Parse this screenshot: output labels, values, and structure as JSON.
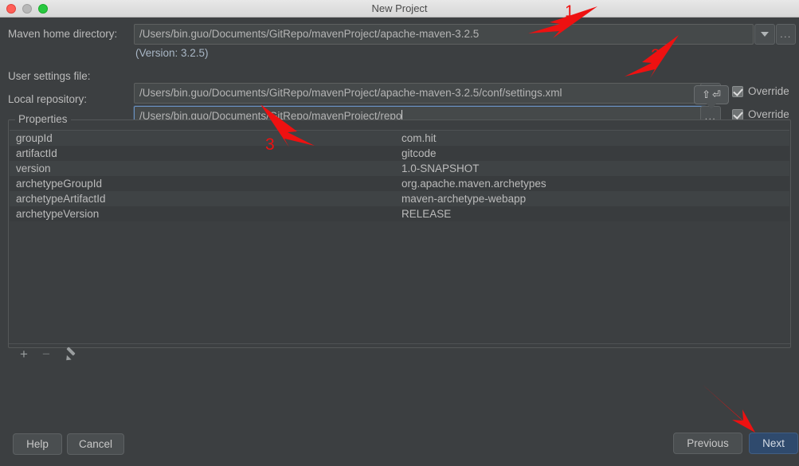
{
  "window": {
    "title": "New Project",
    "traffic_lights": [
      "close-button",
      "minimize-button",
      "maximize-button"
    ]
  },
  "form": {
    "maven_home": {
      "label": "Maven home directory:",
      "value": "/Users/bin.guo/Documents/GitRepo/mavenProject/apache-maven-3.2.5",
      "dropdown_icon": "chevron-down-icon",
      "browse_label": "...",
      "version_note": "(Version: 3.2.5)"
    },
    "user_settings": {
      "label": "User settings file:",
      "value": "/Users/bin.guo/Documents/GitRepo/mavenProject/apache-maven-3.2.5/conf/settings.xml",
      "browse_label": "...",
      "override_label": "Override",
      "override_checked": true
    },
    "local_repository": {
      "label": "Local repository:",
      "value": "/Users/bin.guo/Documents/GitRepo/mavenProject/repo",
      "browse_label": "...",
      "override_label": "Override",
      "override_checked": true,
      "focused": true
    }
  },
  "shortcut_tooltip": {
    "shift_glyph": "⇧",
    "enter_glyph": "⏎"
  },
  "properties": {
    "legend": "Properties",
    "rows": [
      {
        "key": "groupId",
        "value": "com.hit"
      },
      {
        "key": "artifactId",
        "value": "gitcode"
      },
      {
        "key": "version",
        "value": "1.0-SNAPSHOT"
      },
      {
        "key": "archetypeGroupId",
        "value": "org.apache.maven.archetypes"
      },
      {
        "key": "archetypeArtifactId",
        "value": "maven-archetype-webapp"
      },
      {
        "key": "archetypeVersion",
        "value": "RELEASE"
      }
    ],
    "toolbar": {
      "add_label": "+",
      "remove_label": "−",
      "edit_icon": "pencil-icon"
    }
  },
  "footer": {
    "help_label": "Help",
    "cancel_label": "Cancel",
    "previous_label": "Previous",
    "next_label": "Next"
  },
  "annotations": {
    "arrow_1_label": "1",
    "arrow_2_label": "2",
    "arrow_3_label": "3",
    "color": "#ee1111"
  }
}
